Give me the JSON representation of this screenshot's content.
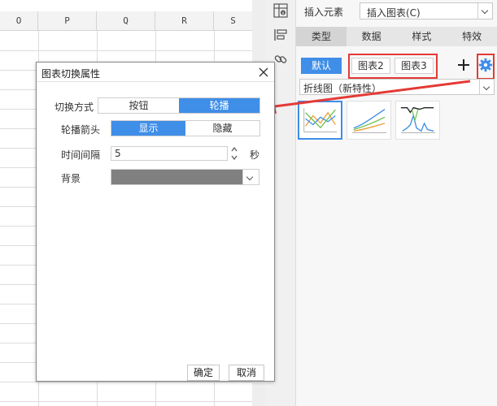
{
  "sheet": {
    "columns": [
      "O",
      "P",
      "Q",
      "R",
      "S"
    ]
  },
  "panel": {
    "insert_label": "插入元素",
    "insert_value": "插入图表(C)",
    "tabs": [
      {
        "label": "类型",
        "active": true
      },
      {
        "label": "数据",
        "active": false
      },
      {
        "label": "样式",
        "active": false
      },
      {
        "label": "特效",
        "active": false
      }
    ],
    "chart_buttons": {
      "default": "默认",
      "chart2": "图表2",
      "chart3": "图表3"
    },
    "chart_type": "折线图（新特性）"
  },
  "dialog": {
    "title": "图表切换属性",
    "switch_mode": {
      "label": "切换方式",
      "options": [
        "按钮",
        "轮播"
      ],
      "selected": "轮播"
    },
    "arrow": {
      "label": "轮播箭头",
      "options": [
        "显示",
        "隐藏"
      ],
      "selected": "显示"
    },
    "interval": {
      "label": "时间间隔",
      "value": "5",
      "unit": "秒"
    },
    "background": {
      "label": "背景",
      "color": "#808080"
    },
    "ok": "确定",
    "cancel": "取消"
  },
  "colors": {
    "accent": "#3f8ee8",
    "highlight": "#e43a36"
  }
}
